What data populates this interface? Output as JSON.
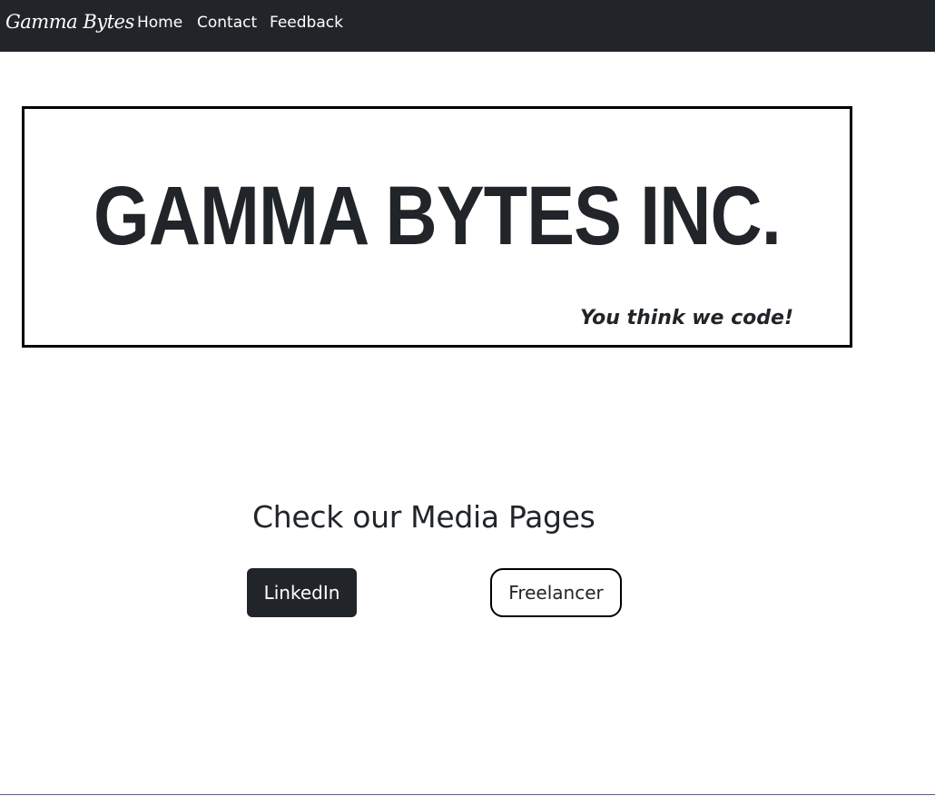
{
  "navbar": {
    "brand": "Gamma Bytes",
    "links": [
      "Home",
      "Contact",
      "Feedback"
    ]
  },
  "banner": {
    "title": "GAMMA BYTES INC.",
    "tagline": "You think we code!"
  },
  "media": {
    "heading": "Check our Media Pages",
    "buttons": [
      "LinkedIn",
      "Freelancer"
    ]
  },
  "colors": {
    "navbar_bg": "#212529",
    "text_dark": "#212529",
    "banner_border": "#000000",
    "page_bg": "#ffffff"
  }
}
